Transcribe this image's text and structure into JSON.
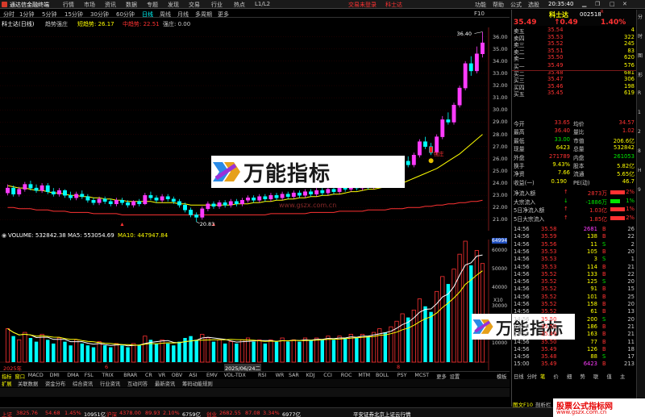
{
  "menubar": {
    "app_title": "通达信金融终端",
    "items": [
      "行情",
      "市场",
      "资讯",
      "数据",
      "专题",
      "发现",
      "交易",
      "行业",
      "热点",
      "L1/L2"
    ],
    "notice": "交易未登录",
    "stock_tag": "科士达",
    "right_items": [
      "功能",
      "帮助",
      "公式",
      "选股"
    ],
    "time": "20:35:40"
  },
  "periodbar": {
    "items": [
      "分时",
      "1分钟",
      "5分钟",
      "15分钟",
      "30分钟",
      "60分钟",
      "日线",
      "周线",
      "月线",
      "多周期",
      "更多"
    ],
    "selected": "日线",
    "f10": "F10"
  },
  "ind_header": {
    "stock": "科士达(日线)",
    "indicator": "趋势强庄",
    "line1": "短趋势: 26.17",
    "line2": "中趋势: 22.51",
    "line3": "强庄: 0.00"
  },
  "price_axis": [
    "36.00",
    "35.00",
    "34.00",
    "33.00",
    "32.00",
    "31.00",
    "30.00",
    "29.00",
    "28.00",
    "27.00",
    "26.00",
    "25.00",
    "24.00",
    "23.00",
    "22.00",
    "21.00"
  ],
  "annotations": {
    "high": "36.40",
    "low": "20.83",
    "signal": "强庄"
  },
  "watermark": {
    "text": "万能指标",
    "url": "www.gszx.com.cn"
  },
  "vol_header": {
    "volume": "VOLUME: 532842.38",
    "ma5": "MA5: 553054.69",
    "ma10": "MA10: 447947.84"
  },
  "vol_axis": [
    "64994",
    "60000",
    "50000",
    "40000",
    "30000",
    "20000",
    "10000"
  ],
  "vol_axis_unit": "X10",
  "date_labels": {
    "left": "2025年",
    "mid": "2025/06/24二",
    "m6": "6",
    "m8": "8"
  },
  "tabs_row1": [
    "指标",
    "窗口",
    "MACD",
    "DMI",
    "DMA",
    "FSL",
    "TRIX",
    "BRAR",
    "CR",
    "VR",
    "OBV",
    "ASI",
    "EMV",
    "VOL-TDX",
    "RSI",
    "WR",
    "SAR",
    "KDJ",
    "CCI",
    "ROC",
    "MTM",
    "BOLL",
    "PSY",
    "MCST",
    "更多",
    "设置"
  ],
  "tabs_row2": [
    "扩展",
    "关联数据",
    "资金分布",
    "综合资讯",
    "行业资讯",
    "互动问答",
    "最新资讯",
    "筹码动能规则"
  ],
  "tabs_right": [
    "模板"
  ],
  "chart_data": {
    "type": "candlestick",
    "price_ylim": [
      20.5,
      36.5
    ],
    "candles": [
      [
        23.2,
        23.6,
        23.9,
        23.0
      ],
      [
        23.6,
        23.1,
        23.8,
        22.9
      ],
      [
        23.1,
        23.5,
        23.7,
        22.9
      ],
      [
        23.5,
        23.9,
        24.1,
        23.3
      ],
      [
        23.9,
        23.6,
        24.2,
        23.4
      ],
      [
        23.6,
        23.4,
        23.9,
        23.2
      ],
      [
        23.4,
        23.8,
        24.0,
        23.2
      ],
      [
        23.8,
        23.3,
        24.0,
        23.1
      ],
      [
        23.3,
        23.1,
        23.6,
        22.9
      ],
      [
        23.1,
        23.4,
        23.6,
        22.9
      ],
      [
        23.4,
        23.0,
        23.5,
        22.8
      ],
      [
        23.0,
        22.8,
        23.3,
        22.6
      ],
      [
        22.8,
        23.1,
        23.3,
        22.6
      ],
      [
        23.1,
        22.9,
        23.4,
        22.7
      ],
      [
        22.9,
        22.6,
        23.1,
        22.4
      ],
      [
        22.6,
        22.4,
        22.8,
        22.2
      ],
      [
        22.4,
        22.7,
        22.9,
        22.2
      ],
      [
        22.7,
        22.5,
        22.9,
        22.3
      ],
      [
        22.5,
        22.3,
        22.7,
        22.1
      ],
      [
        22.3,
        22.6,
        22.8,
        22.1
      ],
      [
        22.6,
        22.4,
        22.8,
        22.2
      ],
      [
        22.4,
        22.2,
        22.6,
        22.0
      ],
      [
        22.2,
        22.5,
        22.6,
        22.0
      ],
      [
        22.5,
        22.3,
        22.7,
        22.1
      ],
      [
        22.3,
        23.0,
        23.2,
        22.2
      ],
      [
        23.0,
        22.8,
        23.3,
        22.6
      ],
      [
        22.8,
        22.6,
        23.0,
        22.4
      ],
      [
        22.6,
        22.9,
        23.1,
        22.4
      ],
      [
        22.9,
        22.7,
        23.1,
        22.5
      ],
      [
        22.7,
        22.5,
        22.9,
        22.3
      ],
      [
        22.5,
        22.2,
        22.7,
        22.0
      ],
      [
        22.2,
        21.8,
        22.4,
        21.6
      ],
      [
        21.8,
        21.4,
        22.0,
        21.2
      ],
      [
        21.4,
        21.2,
        21.6,
        20.83
      ],
      [
        21.2,
        21.9,
        22.1,
        21.0
      ],
      [
        21.9,
        22.3,
        22.5,
        21.7
      ],
      [
        22.3,
        22.1,
        22.5,
        21.9
      ],
      [
        22.1,
        22.4,
        22.6,
        21.9
      ],
      [
        22.4,
        22.2,
        22.6,
        22.0
      ],
      [
        22.2,
        22.5,
        22.7,
        22.0
      ],
      [
        22.5,
        22.3,
        22.7,
        22.1
      ],
      [
        22.3,
        22.6,
        22.8,
        22.1
      ],
      [
        22.6,
        22.8,
        23.0,
        22.4
      ],
      [
        22.8,
        22.6,
        23.0,
        22.4
      ],
      [
        22.6,
        22.9,
        23.1,
        22.4
      ],
      [
        22.9,
        22.7,
        23.1,
        22.5
      ],
      [
        22.7,
        23.0,
        23.2,
        22.5
      ],
      [
        23.0,
        22.8,
        23.2,
        22.6
      ],
      [
        22.8,
        23.1,
        23.3,
        22.6
      ],
      [
        23.1,
        22.9,
        23.3,
        22.7
      ],
      [
        22.9,
        23.2,
        23.4,
        22.7
      ],
      [
        23.2,
        23.0,
        23.4,
        22.8
      ],
      [
        23.0,
        23.3,
        23.5,
        22.8
      ],
      [
        23.3,
        23.1,
        23.5,
        22.9
      ],
      [
        23.1,
        23.4,
        23.6,
        22.9
      ],
      [
        23.4,
        23.2,
        23.6,
        23.0
      ],
      [
        23.2,
        23.5,
        23.7,
        23.0
      ],
      [
        23.5,
        23.3,
        23.7,
        23.1
      ],
      [
        23.3,
        23.7,
        23.9,
        23.1
      ],
      [
        23.7,
        23.5,
        23.9,
        23.3
      ],
      [
        23.5,
        23.8,
        24.0,
        23.3
      ],
      [
        23.8,
        23.6,
        24.0,
        23.4
      ],
      [
        23.6,
        23.9,
        24.1,
        23.4
      ],
      [
        23.9,
        23.7,
        24.1,
        23.5
      ],
      [
        23.7,
        24.0,
        24.2,
        23.5
      ],
      [
        24.0,
        24.3,
        24.5,
        23.8
      ],
      [
        24.3,
        24.1,
        24.5,
        23.9
      ],
      [
        24.1,
        24.6,
        24.8,
        23.9
      ],
      [
        24.6,
        25.2,
        25.4,
        24.4
      ],
      [
        25.2,
        25.8,
        26.0,
        25.0
      ],
      [
        25.8,
        25.5,
        26.2,
        25.3
      ],
      [
        25.5,
        26.3,
        26.5,
        25.3
      ],
      [
        26.3,
        27.4,
        27.6,
        26.1
      ],
      [
        27.4,
        27.0,
        27.8,
        26.8
      ],
      [
        27.0,
        26.5,
        27.3,
        26.3
      ],
      [
        26.5,
        27.8,
        28.0,
        26.3
      ],
      [
        27.8,
        29.2,
        29.5,
        27.6
      ],
      [
        29.2,
        29.0,
        29.8,
        28.8
      ],
      [
        29.0,
        30.4,
        30.6,
        28.8
      ],
      [
        30.4,
        31.8,
        32.0,
        30.2
      ],
      [
        31.8,
        33.8,
        34.0,
        31.6
      ],
      [
        33.8,
        33.2,
        34.4,
        32.8
      ],
      [
        33.2,
        34.6,
        35.2,
        33.0
      ],
      [
        34.6,
        35.5,
        36.4,
        34.3
      ]
    ],
    "ma_short_approx": [
      23.8,
      23.7,
      23.6,
      23.6,
      23.5,
      23.4,
      23.4,
      23.3,
      23.2,
      23.2,
      23.1,
      23.0,
      23.0,
      22.9,
      22.9,
      22.8,
      22.8,
      22.7,
      22.7,
      22.6,
      22.6,
      22.5,
      22.5,
      22.5,
      22.5,
      22.5,
      22.4,
      22.4,
      22.4,
      22.4,
      22.3,
      22.3,
      22.2,
      22.2,
      22.2,
      22.2,
      22.2,
      22.2,
      22.2,
      22.2,
      22.3,
      22.3,
      22.3,
      22.4,
      22.4,
      22.5,
      22.5,
      22.6,
      22.6,
      22.7,
      22.7,
      22.8,
      22.8,
      22.9,
      22.9,
      23.0,
      23.0,
      23.1,
      23.1,
      23.2,
      23.3,
      23.3,
      23.4,
      23.5,
      23.5,
      23.6,
      23.7,
      23.8,
      23.9,
      24.0,
      24.2,
      24.4,
      24.6,
      24.8,
      25.0,
      25.2,
      25.5,
      25.8,
      26.1,
      26.4,
      26.8,
      27.2,
      27.6,
      28.0
    ],
    "ma_long_approx": [
      22.0,
      22.0,
      21.9,
      21.9,
      21.9,
      21.8,
      21.8,
      21.8,
      21.7,
      21.7,
      21.7,
      21.6,
      21.6,
      21.6,
      21.6,
      21.5,
      21.5,
      21.5,
      21.5,
      21.5,
      21.4,
      21.4,
      21.4,
      21.4,
      21.4,
      21.4,
      21.4,
      21.4,
      21.4,
      21.4,
      21.4,
      21.4,
      21.4,
      21.4,
      21.4,
      21.4,
      21.4,
      21.4,
      21.4,
      21.4,
      21.4,
      21.4,
      21.4,
      21.4,
      21.4,
      21.4,
      21.5,
      21.5,
      21.5,
      21.5,
      21.5,
      21.5,
      21.5,
      21.6,
      21.6,
      21.6,
      21.6,
      21.6,
      21.7,
      21.7,
      21.7,
      21.7,
      21.7,
      21.8,
      21.8,
      21.8,
      21.8,
      21.9,
      21.9,
      21.9,
      22.0,
      22.0,
      22.0,
      22.1,
      22.1,
      22.2,
      22.2,
      22.3,
      22.3,
      22.4,
      22.4,
      22.5,
      22.5,
      22.6
    ],
    "volumes": [
      18,
      14,
      12,
      16,
      13,
      11,
      15,
      12,
      10,
      13,
      11,
      9,
      12,
      10,
      9,
      8,
      11,
      9,
      8,
      10,
      9,
      8,
      10,
      9,
      14,
      12,
      10,
      12,
      10,
      9,
      11,
      13,
      14,
      12,
      15,
      13,
      11,
      12,
      10,
      11,
      10,
      12,
      13,
      11,
      12,
      10,
      12,
      11,
      13,
      11,
      12,
      11,
      13,
      12,
      13,
      12,
      14,
      12,
      14,
      13,
      15,
      13,
      15,
      14,
      16,
      18,
      16,
      19,
      22,
      26,
      24,
      28,
      34,
      30,
      27,
      38,
      46,
      42,
      50,
      58,
      65,
      52,
      60,
      53
    ],
    "vol_ylim": [
      0,
      65
    ]
  },
  "quote": {
    "name": "科士达",
    "code": "002518",
    "flag": "R",
    "price": "35.49",
    "change": "↑0.49",
    "pct": "1.40%",
    "sell": [
      {
        "label": "卖五",
        "price": "35.54",
        "vol": "4"
      },
      {
        "label": "卖四",
        "price": "35.53",
        "vol": "322"
      },
      {
        "label": "卖三",
        "price": "35.52",
        "vol": "245"
      },
      {
        "label": "卖二",
        "price": "35.51",
        "vol": "83"
      },
      {
        "label": "卖一",
        "price": "35.50",
        "vol": "620"
      }
    ],
    "buy": [
      {
        "label": "买一",
        "price": "35.49",
        "vol": "576"
      },
      {
        "label": "买二",
        "price": "35.48",
        "vol": "681"
      },
      {
        "label": "买三",
        "price": "35.47",
        "vol": "306"
      },
      {
        "label": "买四",
        "price": "35.46",
        "vol": "198"
      },
      {
        "label": "买五",
        "price": "35.45",
        "vol": "619"
      }
    ],
    "stats": [
      {
        "l1": "今开",
        "v1": "33.65",
        "l2": "均价",
        "v2": "34.57"
      },
      {
        "l1": "最高",
        "v1": "36.40",
        "l2": "量比",
        "v2": "1.02"
      },
      {
        "l1": "最低",
        "v1": "33.00",
        "l2": "市值",
        "v2": "206.6亿"
      },
      {
        "l1": "现量",
        "v1": "6423",
        "l2": "总量",
        "v2": "532842"
      },
      {
        "l1": "外盘",
        "v1": "271789",
        "l2": "内盘",
        "v2": "261053"
      },
      {
        "l1": "换手",
        "v1": "9.43%",
        "l2": "股本",
        "v2": "5.82亿"
      },
      {
        "l1": "净资",
        "v1": "7.66",
        "l2": "流通",
        "v2": "5.65亿"
      },
      {
        "l1": "收益(一)",
        "v1": "0.190",
        "l2": "PE(动)",
        "v2": "46.7"
      }
    ],
    "flows": [
      {
        "label": "净流入额",
        "value": "2873万",
        "pct": "2%"
      },
      {
        "label": "大宗流入",
        "value": "-1886万",
        "pct": "1%"
      },
      {
        "label": "5日净流入额",
        "value": "1.03亿",
        "pct": "1%"
      },
      {
        "label": "5日大宗流入",
        "value": "1.85亿",
        "pct": "2%"
      }
    ],
    "ticks": [
      {
        "t": "14:56",
        "p": "35.58",
        "v": "2681",
        "d": "B",
        "n": "26"
      },
      {
        "t": "14:56",
        "p": "35.59",
        "v": "138",
        "d": "B",
        "n": "22"
      },
      {
        "t": "14:56",
        "p": "35.56",
        "v": "11",
        "d": "S",
        "n": "2"
      },
      {
        "t": "14:56",
        "p": "35.53",
        "v": "105",
        "d": "B",
        "n": "20"
      },
      {
        "t": "14:56",
        "p": "35.53",
        "v": "3",
        "d": "S",
        "n": "1"
      },
      {
        "t": "14:56",
        "p": "35.53",
        "v": "114",
        "d": "B",
        "n": "21"
      },
      {
        "t": "14:56",
        "p": "35.52",
        "v": "133",
        "d": "B",
        "n": "22"
      },
      {
        "t": "14:56",
        "p": "35.52",
        "v": "125",
        "d": "S",
        "n": "20"
      },
      {
        "t": "14:56",
        "p": "35.52",
        "v": "91",
        "d": "B",
        "n": "15"
      },
      {
        "t": "14:56",
        "p": "35.52",
        "v": "101",
        "d": "B",
        "n": "25"
      },
      {
        "t": "14:56",
        "p": "35.52",
        "v": "158",
        "d": "B",
        "n": "20"
      },
      {
        "t": "14:56",
        "p": "35.52",
        "v": "61",
        "d": "B",
        "n": "13"
      },
      {
        "t": "14:56",
        "p": "35.50",
        "v": "200",
        "d": "S",
        "n": "20"
      },
      {
        "t": "14:56",
        "p": "35.50",
        "v": "186",
        "d": "B",
        "n": "21"
      },
      {
        "t": "14:56",
        "p": "35.49",
        "v": "163",
        "d": "B",
        "n": "21"
      },
      {
        "t": "14:56",
        "p": "35.50",
        "v": "77",
        "d": "B",
        "n": "11"
      },
      {
        "t": "14:56",
        "p": "35.49",
        "v": "126",
        "d": "B",
        "n": "18"
      },
      {
        "t": "14:56",
        "p": "35.48",
        "v": "88",
        "d": "S",
        "n": "17"
      },
      {
        "t": "15:00",
        "p": "35.49",
        "v": "6423",
        "d": "B",
        "n": "213"
      }
    ],
    "bottom_tabs": [
      "日线",
      "分时",
      "笔",
      "价",
      "细",
      "势",
      "联",
      "值",
      "主"
    ]
  },
  "rstrip": [
    "分",
    "时",
    "图",
    "形",
    "R",
    "1",
    "2",
    "8",
    "H",
    "9"
  ],
  "statusbar": {
    "sh_label": "上证",
    "sh_val": "3825.76",
    "sh_chg": "54.68",
    "sh_pct": "1.45%",
    "sh_amt": "10951亿",
    "sz_label": "沪深",
    "sz_val": "4378.00",
    "sz_chg": "89.93",
    "sz_pct": "2.10%",
    "sz_amt": "6759亿",
    "cy_label": "创业",
    "cy_val": "2682.55",
    "cy_chg": "87.08",
    "cy_pct": "3.34%",
    "cy_amt": "6977亿",
    "feed": "平安证券北京上证云行情",
    "right_tags": [
      "图文F10",
      "剖析栏"
    ]
  },
  "corner_brand": {
    "line1": "股票公式指标网",
    "line2": "www.gszx.com.cn"
  },
  "colors": {
    "up": "#ff3232",
    "down": "#00ffff",
    "ma_short": "#ffff00",
    "ma_long": "#ff3232",
    "magenta": "#ff3cff",
    "bg": "#000000"
  }
}
